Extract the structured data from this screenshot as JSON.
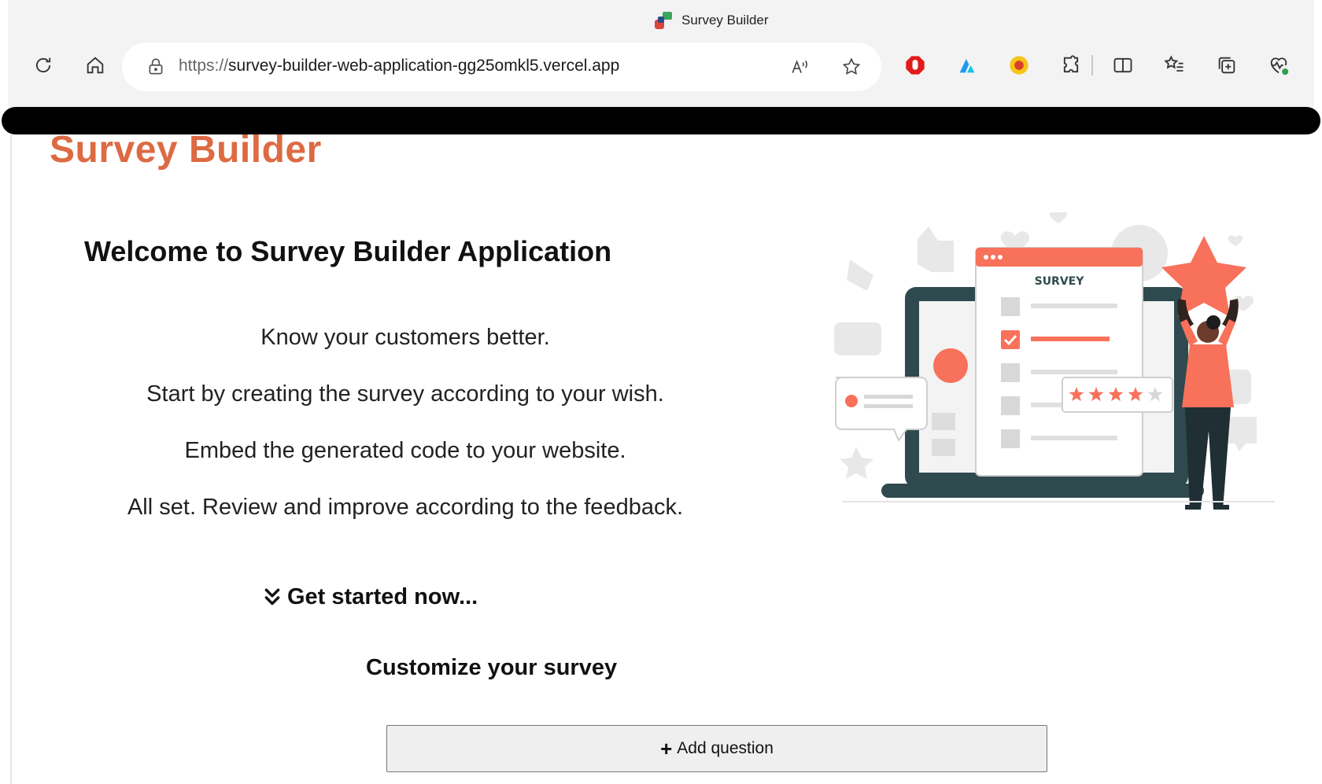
{
  "browser": {
    "tab_title": "Survey Builder",
    "url_scheme": "https://",
    "url_host": "survey-builder-web-application-gg25omkl5.vercel.app",
    "icons": [
      "refresh-icon",
      "home-icon",
      "lock-icon",
      "read-aloud-icon",
      "favorite-star-icon",
      "adblock-extension-icon",
      "extension-icon-2",
      "extension-icon-3",
      "extensions-puzzle-icon",
      "split-screen-icon",
      "favorites-list-icon",
      "collections-icon",
      "browser-essentials-icon"
    ]
  },
  "page": {
    "brand": "Survey Builder",
    "welcome_title": "Welcome to Survey Builder Application",
    "steps": [
      "Know your customers better.",
      "Start by creating the survey according to your wish.",
      "Embed the generated code to your website.",
      "All set. Review and improve according to the feedback."
    ],
    "get_started": "Get started now...",
    "customize_title": "Customize your survey",
    "add_question_label": "Add question",
    "illustration": {
      "survey_label": "SURVEY",
      "rating_stars": 4,
      "rating_max": 5
    }
  },
  "colors": {
    "brand": "#dd6a43",
    "coral": "#f8715b",
    "dark_teal": "#2f4a4f"
  }
}
